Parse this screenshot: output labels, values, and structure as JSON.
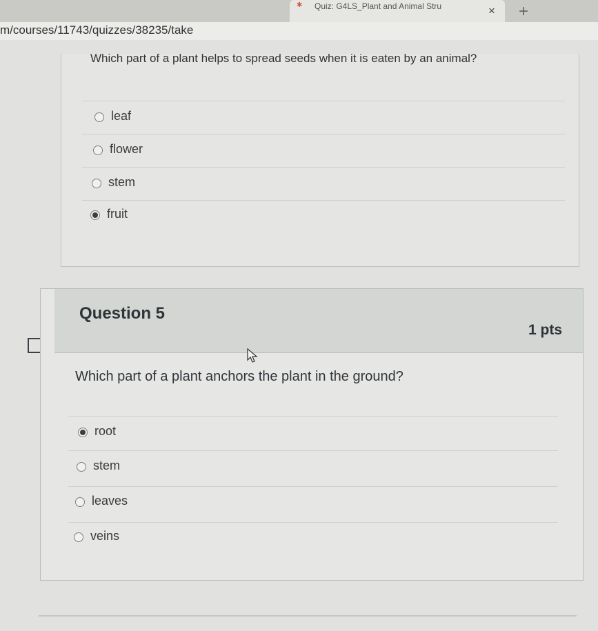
{
  "browser": {
    "tab_title": "Quiz: G4LS_Plant and Animal Stru",
    "tab_close": "×",
    "new_tab": "+",
    "url": "m/courses/11743/quizzes/38235/take"
  },
  "question4": {
    "text": "Which part of a plant helps to spread seeds when it is eaten by an animal?",
    "options": [
      {
        "label": "leaf",
        "selected": false
      },
      {
        "label": "flower",
        "selected": false
      },
      {
        "label": "stem",
        "selected": false
      },
      {
        "label": "fruit",
        "selected": true
      }
    ]
  },
  "question5": {
    "title": "Question 5",
    "points": "1 pts",
    "text": "Which part of a plant anchors the plant in the ground?",
    "options": [
      {
        "label": "root",
        "selected": true
      },
      {
        "label": "stem",
        "selected": false
      },
      {
        "label": "leaves",
        "selected": false
      },
      {
        "label": "veins",
        "selected": false
      }
    ]
  },
  "icons": {
    "flag": "flag-question-icon",
    "cursor": "mouse-pointer-icon"
  }
}
